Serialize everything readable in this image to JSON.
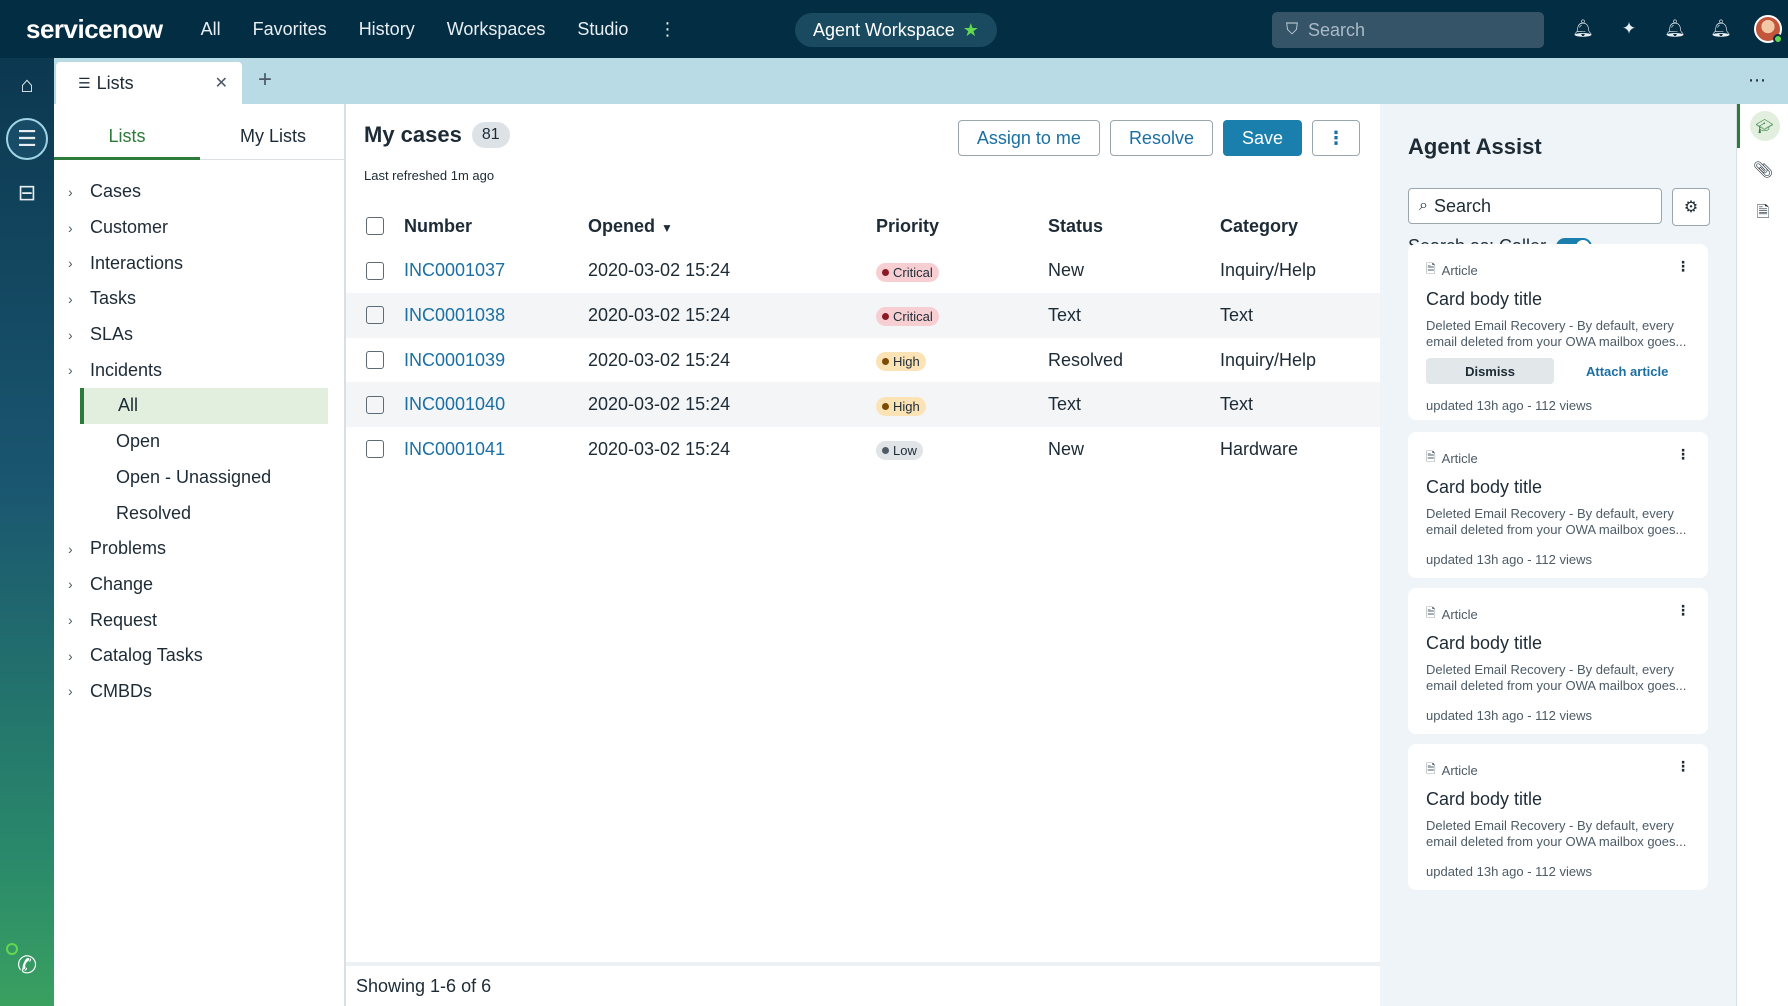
{
  "topnav": {
    "logo": "servicenow",
    "items": [
      "All",
      "Favorites",
      "History",
      "Workspaces",
      "Studio"
    ],
    "more": "⋮",
    "workspace": "Agent Workspace",
    "search_placeholder": "Search"
  },
  "tabs": {
    "active_label": "Lists",
    "add": "+",
    "more": "⋯"
  },
  "lists": {
    "tabs": [
      "Lists",
      "My Lists"
    ],
    "tree": [
      {
        "label": "Cases"
      },
      {
        "label": "Customer"
      },
      {
        "label": "Interactions"
      },
      {
        "label": "Tasks"
      },
      {
        "label": "SLAs"
      },
      {
        "label": "Incidents"
      },
      {
        "label": "All",
        "child": true,
        "selected": true
      },
      {
        "label": "Open",
        "child": true
      },
      {
        "label": "Open - Unassigned",
        "child": true
      },
      {
        "label": "Resolved",
        "child": true
      },
      {
        "label": "Problems"
      },
      {
        "label": "Change"
      },
      {
        "label": "Request"
      },
      {
        "label": "Catalog Tasks"
      },
      {
        "label": "CMBDs"
      }
    ]
  },
  "main": {
    "title": "My cases",
    "count": "81",
    "refreshed": "Last refreshed 1m ago",
    "actions": {
      "assign": "Assign to me",
      "resolve": "Resolve",
      "save": "Save",
      "more": "⋮"
    },
    "columns": [
      "Number",
      "Opened",
      "Priority",
      "Status",
      "Category"
    ],
    "rows": [
      {
        "number": "INC0001037",
        "opened": "2020-03-02 15:24",
        "priority": "Critical",
        "status": "New",
        "category": "Inquiry/Help"
      },
      {
        "number": "INC0001038",
        "opened": "2020-03-02 15:24",
        "priority": "Critical",
        "status": "Text",
        "category": "Text"
      },
      {
        "number": "INC0001039",
        "opened": "2020-03-02 15:24",
        "priority": "High",
        "status": "Resolved",
        "category": "Inquiry/Help"
      },
      {
        "number": "INC0001040",
        "opened": "2020-03-02 15:24",
        "priority": "High",
        "status": "Text",
        "category": "Text"
      },
      {
        "number": "INC0001041",
        "opened": "2020-03-02 15:24",
        "priority": "Low",
        "status": "New",
        "category": "Hardware"
      }
    ],
    "footer": "Showing 1-6 of 6"
  },
  "assist": {
    "title": "Agent Assist",
    "search_value": "Search",
    "search_as": "Search as: Caller",
    "cards": [
      {
        "type": "Article",
        "title": "Card body title",
        "body": "Deleted Email Recovery - By default, every email deleted from your OWA mailbox goes...",
        "dismiss": "Dismiss",
        "attach": "Attach article",
        "meta": "updated 13h ago - 112 views"
      },
      {
        "type": "Article",
        "title": "Card body title",
        "body": "Deleted Email Recovery - By default, every email deleted from your OWA mailbox goes...",
        "meta": "updated 13h ago - 112 views"
      },
      {
        "type": "Article",
        "title": "Card body title",
        "body": "Deleted Email Recovery - By default, every email deleted from your OWA mailbox goes...",
        "meta": "updated 13h ago - 112 views"
      },
      {
        "type": "Article",
        "title": "Card body title",
        "body": "Deleted Email Recovery - By default, every email deleted from your OWA mailbox goes...",
        "meta": "updated 13h ago - 112 views"
      }
    ]
  },
  "colors": {
    "nav": "#032d42",
    "accent_green": "#2d7b3a",
    "link_blue": "#1b6fa3",
    "primary_btn": "#1b7fae"
  }
}
